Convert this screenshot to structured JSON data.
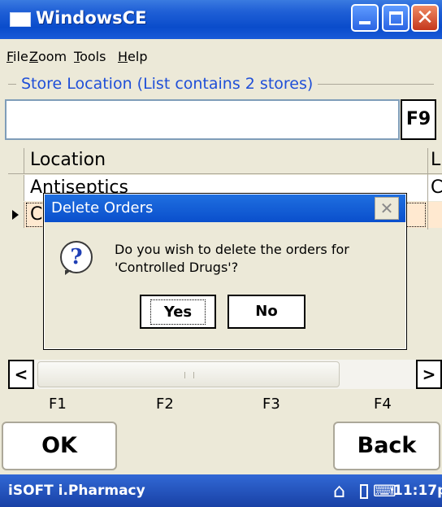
{
  "window": {
    "title": "WindowsCE",
    "close_glyph": "✕"
  },
  "menu": [
    "File",
    "Zoom",
    "Tools",
    "Help"
  ],
  "store": {
    "group_title": "Store Location (List contains 2 stores)",
    "search_value": "",
    "f9_label": "F9"
  },
  "grid": {
    "columns": [
      "Location",
      "L"
    ],
    "rows": [
      {
        "location": "Antiseptics",
        "col2": "C"
      },
      {
        "location": "C",
        "col2": ""
      }
    ]
  },
  "scrollbar": {
    "left_glyph": "<",
    "right_glyph": ">"
  },
  "function_keys": [
    "F1",
    "F2",
    "F3",
    "F4"
  ],
  "buttons": {
    "ok": "OK",
    "back": "Back"
  },
  "taskbar": {
    "app": "iSOFT i.Pharmacy",
    "time": "11:17p",
    "home_icon": "⌂",
    "keyboard_icon": "⌨"
  },
  "dialog": {
    "title": "Delete Orders",
    "close_glyph": "✕",
    "icon": "?",
    "message": "Do you wish to delete the orders for 'Controlled Drugs'?",
    "yes": "Yes",
    "no": "No"
  }
}
